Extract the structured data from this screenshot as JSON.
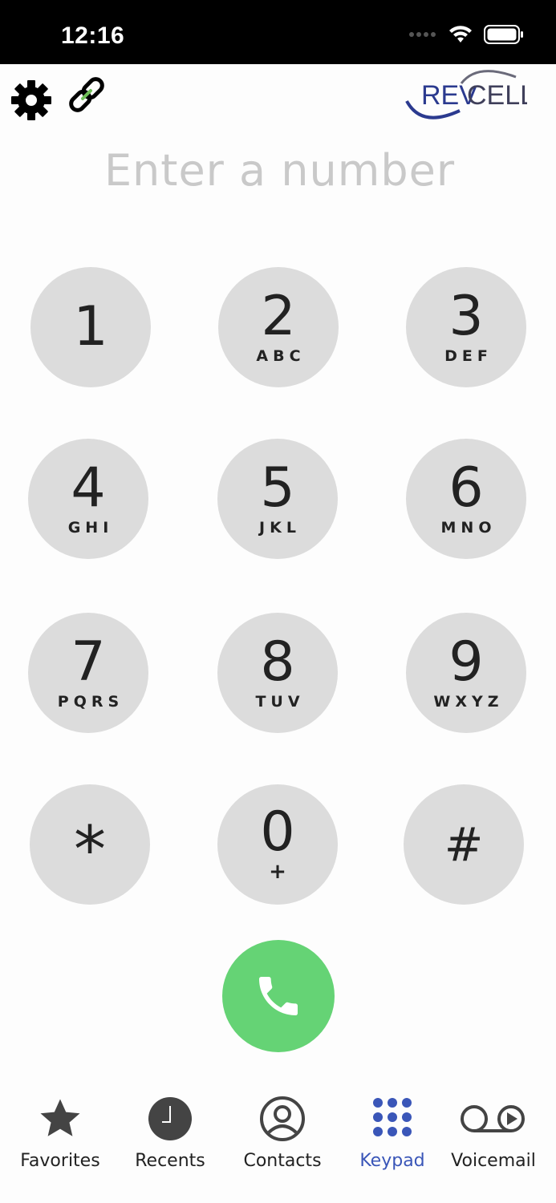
{
  "status_bar": {
    "time": "12:16"
  },
  "logo": {
    "part1": "REV",
    "part2": "CELL",
    "color1": "#2b3a8f",
    "color2": "#3f3f5a"
  },
  "number_input": {
    "placeholder": "Enter a number",
    "value": ""
  },
  "keypad": [
    {
      "digit": "1",
      "letters": ""
    },
    {
      "digit": "2",
      "letters": "ABC"
    },
    {
      "digit": "3",
      "letters": "DEF"
    },
    {
      "digit": "4",
      "letters": "GHI"
    },
    {
      "digit": "5",
      "letters": "JKL"
    },
    {
      "digit": "6",
      "letters": "MNO"
    },
    {
      "digit": "7",
      "letters": "PQRS"
    },
    {
      "digit": "8",
      "letters": "TUV"
    },
    {
      "digit": "9",
      "letters": "WXYZ"
    },
    {
      "digit": "*",
      "letters": ""
    },
    {
      "digit": "0",
      "letters": "+"
    },
    {
      "digit": "#",
      "letters": ""
    }
  ],
  "call_button": {
    "icon": "phone-icon",
    "color": "#65d375"
  },
  "tabs": [
    {
      "label": "Favorites",
      "icon": "star-icon",
      "active": false
    },
    {
      "label": "Recents",
      "icon": "clock-icon",
      "active": false
    },
    {
      "label": "Contacts",
      "icon": "person-circle-icon",
      "active": false
    },
    {
      "label": "Keypad",
      "icon": "keypad-grid-icon",
      "active": true
    },
    {
      "label": "Voicemail",
      "icon": "voicemail-icon",
      "active": false
    }
  ],
  "colors": {
    "active_tab": "#3a56b8",
    "key_bg": "#dcdcdc",
    "link_accent": "#6fbf57"
  }
}
